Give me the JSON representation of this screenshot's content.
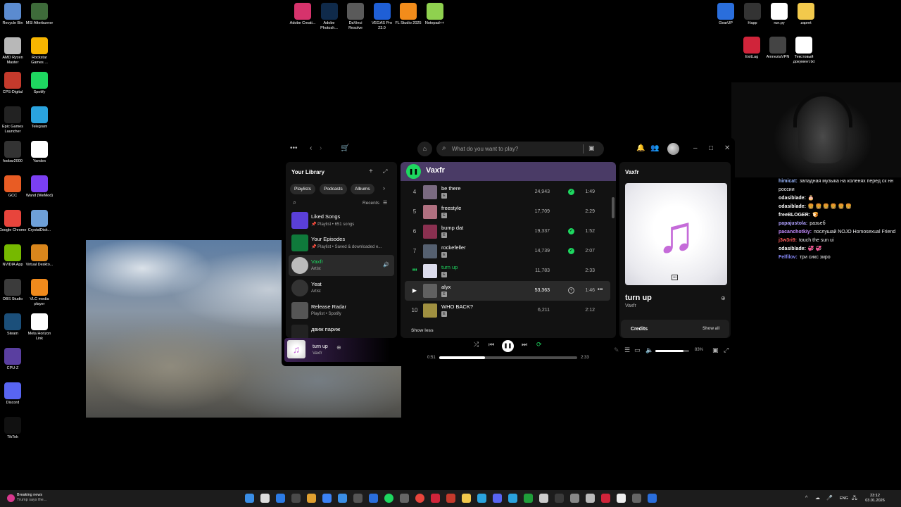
{
  "desktop_icons_left": [
    {
      "label": "Recycle Bin",
      "icon": "recycle-bin-icon",
      "color": "#5b8bd0"
    },
    {
      "label": "MSI Afterburner",
      "icon": "afterburner-icon",
      "color": "#3e6b3a"
    },
    {
      "label": "AMD Ryzen Master",
      "icon": "amd-icon",
      "color": "#b8b8b8"
    },
    {
      "label": "Rockstar Games ...",
      "icon": "rockstar-icon",
      "color": "#f7b500"
    },
    {
      "label": "CPS-Digital",
      "icon": "chrome-app-icon",
      "color": "#c43a2c"
    },
    {
      "label": "Spotify",
      "icon": "spotify-icon",
      "color": "#1ed760"
    },
    {
      "label": "Epic Games Launcher",
      "icon": "epic-icon",
      "color": "#222222"
    },
    {
      "label": "Telegram",
      "icon": "telegram-icon",
      "color": "#2aa3de"
    },
    {
      "label": "foobar2000",
      "icon": "foobar-icon",
      "color": "#333333"
    },
    {
      "label": "Yandex",
      "icon": "yandex-icon",
      "color": "#ffffff"
    },
    {
      "label": "GCC",
      "icon": "gcc-icon",
      "color": "#e85c24"
    },
    {
      "label": "Wand (WeMod)",
      "icon": "wand-icon",
      "color": "#7b3ff2"
    },
    {
      "label": "Google Chrome",
      "icon": "chrome-icon",
      "color": "#e8453c"
    },
    {
      "label": "CrystalDisk...",
      "icon": "crystaldisk-icon",
      "color": "#6ea0d8"
    },
    {
      "label": "NVIDIA App",
      "icon": "nvidia-icon",
      "color": "#76b900"
    },
    {
      "label": "Virtual Deskto...",
      "icon": "virtual-desktop-icon",
      "color": "#d9861c"
    },
    {
      "label": "OBS Studio",
      "icon": "obs-icon",
      "color": "#3b3b3b"
    },
    {
      "label": "VLC media player",
      "icon": "vlc-icon",
      "color": "#f08a1c"
    },
    {
      "label": "Steam",
      "icon": "steam-icon",
      "color": "#1b4f7a"
    },
    {
      "label": "Meta Horizon Link",
      "icon": "meta-icon",
      "color": "#ffffff"
    },
    {
      "label": "CPU-Z",
      "icon": "cpuz-icon",
      "color": "#5a3fa0"
    },
    {
      "label": "Discord",
      "icon": "discord-icon",
      "color": "#5865f2"
    },
    {
      "label": "TikTok",
      "icon": "tiktok-icon",
      "color": "#111111"
    }
  ],
  "desktop_icons_top": [
    {
      "label": "Adobe Creati...",
      "icon": "adobe-cc-icon",
      "color": "#d6336c"
    },
    {
      "label": "Adobe Photosh...",
      "icon": "photoshop-icon",
      "color": "#0f2a4a"
    },
    {
      "label": "DaVinci Resolve",
      "icon": "davinci-icon",
      "color": "#5a5a5a"
    },
    {
      "label": "VEGAS Pro 23.0",
      "icon": "vegas-icon",
      "color": "#1f5fd6"
    },
    {
      "label": "FL Studio 2025",
      "icon": "flstudio-icon",
      "color": "#f28c1b"
    },
    {
      "label": "Notepad++",
      "icon": "notepadpp-icon",
      "color": "#8fd14f"
    }
  ],
  "desktop_icons_right": [
    {
      "label": "GearUP",
      "icon": "gearup-icon",
      "color": "#2a6edc"
    },
    {
      "label": "Happ",
      "icon": "happ-icon",
      "color": "#333333"
    },
    {
      "label": "run.py",
      "icon": "python-file-icon",
      "color": "#ffffff"
    },
    {
      "label": "zapret",
      "icon": "folder-icon",
      "color": "#f2c94c"
    },
    {
      "label": "ExitLag",
      "icon": "exitlag-icon",
      "color": "#d0243a"
    },
    {
      "label": "AmneziaVPN",
      "icon": "amnezia-icon",
      "color": "#444444"
    },
    {
      "label": "Текстовый документ.txt",
      "icon": "text-file-icon",
      "color": "#ffffff"
    }
  ],
  "chat": [
    {
      "user": "himicat:",
      "color": "#9ab8ff",
      "text": "западная музыка на коленях перед ск нн россии"
    },
    {
      "user": "odasiblade:",
      "color": "#ffffff",
      "text": "🎂"
    },
    {
      "user": "odasiblade:",
      "color": "#ffffff",
      "text": "🍔 🍔 🍔 🍔 🍔 🍔"
    },
    {
      "user": "freeBLOGER:",
      "color": "#ffffff",
      "text": "🍞"
    },
    {
      "user": "papajustola:",
      "color": "#b0a0ff",
      "text": "разьеб"
    },
    {
      "user": "pacanchotkiy:",
      "color": "#c58cff",
      "text": "послушай NOJO Homosexual Friend"
    },
    {
      "user": "j3w3ri9:",
      "color": "#ff5a5a",
      "text": "touch the sun ui"
    },
    {
      "user": "odasiblade:",
      "color": "#ffffff",
      "text": "💞 💞"
    },
    {
      "user": "Felfilov:",
      "color": "#8a8cff",
      "text": "три сикс зиро"
    }
  ],
  "spotify": {
    "search_placeholder": "What do you want to play?",
    "library": {
      "title": "Your Library",
      "chips": [
        "Playlists",
        "Podcasts",
        "Albums"
      ],
      "recents_label": "Recents",
      "items": [
        {
          "name": "Liked Songs",
          "sub": "📌 Playlist • 651 songs",
          "color": "#5a3fd8",
          "active": false
        },
        {
          "name": "Your Episodes",
          "sub": "📌 Playlist • Saved & downloaded e...",
          "color": "#0f7a3b",
          "active": false
        },
        {
          "name": "Vaxfr",
          "sub": "Artist",
          "color": "#bbbbbb",
          "active": true
        },
        {
          "name": "Yeat",
          "sub": "Artist",
          "color": "#333333",
          "active": false
        },
        {
          "name": "Release Radar",
          "sub": "Playlist • Spotify",
          "color": "#555555",
          "active": false
        },
        {
          "name": "движ париж",
          "sub": "",
          "color": "#222222",
          "active": false
        }
      ]
    },
    "main": {
      "artist": "Vaxfr",
      "tracks": [
        {
          "num": "4",
          "title": "be there",
          "plays": "24,943",
          "saved": true,
          "duration": "1:49",
          "playing": false,
          "hover": false,
          "color": "#7a6a80"
        },
        {
          "num": "5",
          "title": "freestyle",
          "plays": "17,709",
          "saved": false,
          "duration": "2:29",
          "playing": false,
          "hover": false,
          "color": "#b07080"
        },
        {
          "num": "6",
          "title": "bump dat",
          "plays": "19,337",
          "saved": true,
          "duration": "1:52",
          "playing": false,
          "hover": false,
          "color": "#8a3050"
        },
        {
          "num": "7",
          "title": "rockefeller",
          "plays": "14,739",
          "saved": true,
          "duration": "2:07",
          "playing": false,
          "hover": false,
          "color": "#556070"
        },
        {
          "num": "8",
          "title": "turn up",
          "plays": "11,783",
          "saved": false,
          "duration": "2:33",
          "playing": true,
          "hover": false,
          "color": "#dcdcec"
        },
        {
          "num": "9",
          "title": "alyx",
          "plays": "53,363",
          "saved": false,
          "duration": "1:46",
          "playing": false,
          "hover": true,
          "color": "#606060"
        },
        {
          "num": "10",
          "title": "WHO BACK?",
          "plays": "6,211",
          "saved": false,
          "duration": "2:12",
          "playing": false,
          "hover": false,
          "color": "#a09040"
        }
      ],
      "show_less": "Show less"
    },
    "right_panel": {
      "artist_header": "Vaxfr",
      "title": "turn up",
      "artist": "Vaxfr",
      "credits_label": "Credits",
      "show_all_label": "Show all"
    },
    "now_playing": {
      "title": "turn up",
      "artist": "Vaxfr",
      "current_time": "0:51",
      "total_time": "2:33",
      "progress_fraction": 0.33,
      "volume_percent": "83%",
      "volume_fraction": 0.83
    },
    "accent": "#1ed760"
  },
  "taskbar": {
    "news_title": "Breaking news",
    "news_sub": "Trump says the...",
    "lang": "ENG",
    "time": "23:12",
    "date": "03.01.2026"
  }
}
